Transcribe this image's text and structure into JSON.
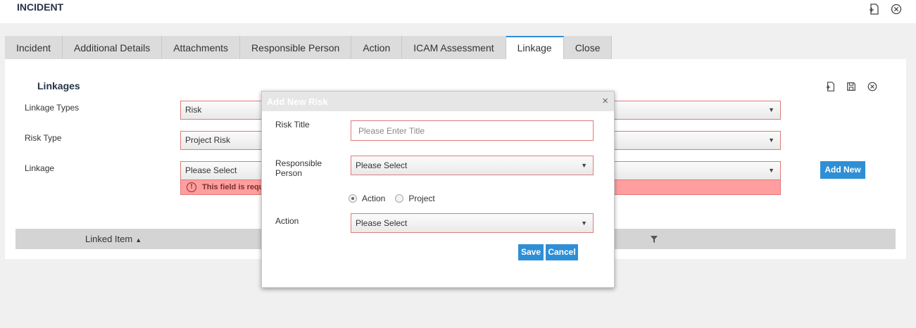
{
  "header": {
    "title": "INCIDENT"
  },
  "tabs": [
    {
      "label": "Incident"
    },
    {
      "label": "Additional Details"
    },
    {
      "label": "Attachments"
    },
    {
      "label": "Responsible Person"
    },
    {
      "label": "Action"
    },
    {
      "label": "ICAM Assessment"
    },
    {
      "label": "Linkage",
      "active": true
    },
    {
      "label": "Close"
    }
  ],
  "linkages": {
    "title": "Linkages",
    "fields": {
      "linkage_types": {
        "label": "Linkage Types",
        "value": "Risk"
      },
      "risk_type": {
        "label": "Risk Type",
        "value": "Project Risk"
      },
      "linkage": {
        "label": "Linkage",
        "value": "Please Select"
      }
    },
    "error": "This field is required",
    "add_new": "Add New",
    "grid": {
      "columns": [
        "Linked Item"
      ],
      "sort_indicator": "▲"
    }
  },
  "modal": {
    "title": "Add New Risk",
    "close": "×",
    "risk_title": {
      "label": "Risk Title",
      "placeholder": "Please Enter Title",
      "value": ""
    },
    "responsible_person": {
      "label": "Responsible Person",
      "value": "Please Select"
    },
    "radio_options": [
      {
        "label": "Action",
        "checked": true
      },
      {
        "label": "Project",
        "checked": false
      }
    ],
    "action": {
      "label": "Action",
      "value": "Please Select"
    },
    "save": "Save",
    "cancel": "Cancel"
  },
  "caret": "▼",
  "icons": [
    "new-document-icon",
    "save-icon",
    "close-circle-icon",
    "filter-icon",
    "warning-icon"
  ],
  "colors": {
    "accent": "#2e8fd6",
    "error": "#ff9e9e",
    "error_border": "#e07a7a"
  }
}
